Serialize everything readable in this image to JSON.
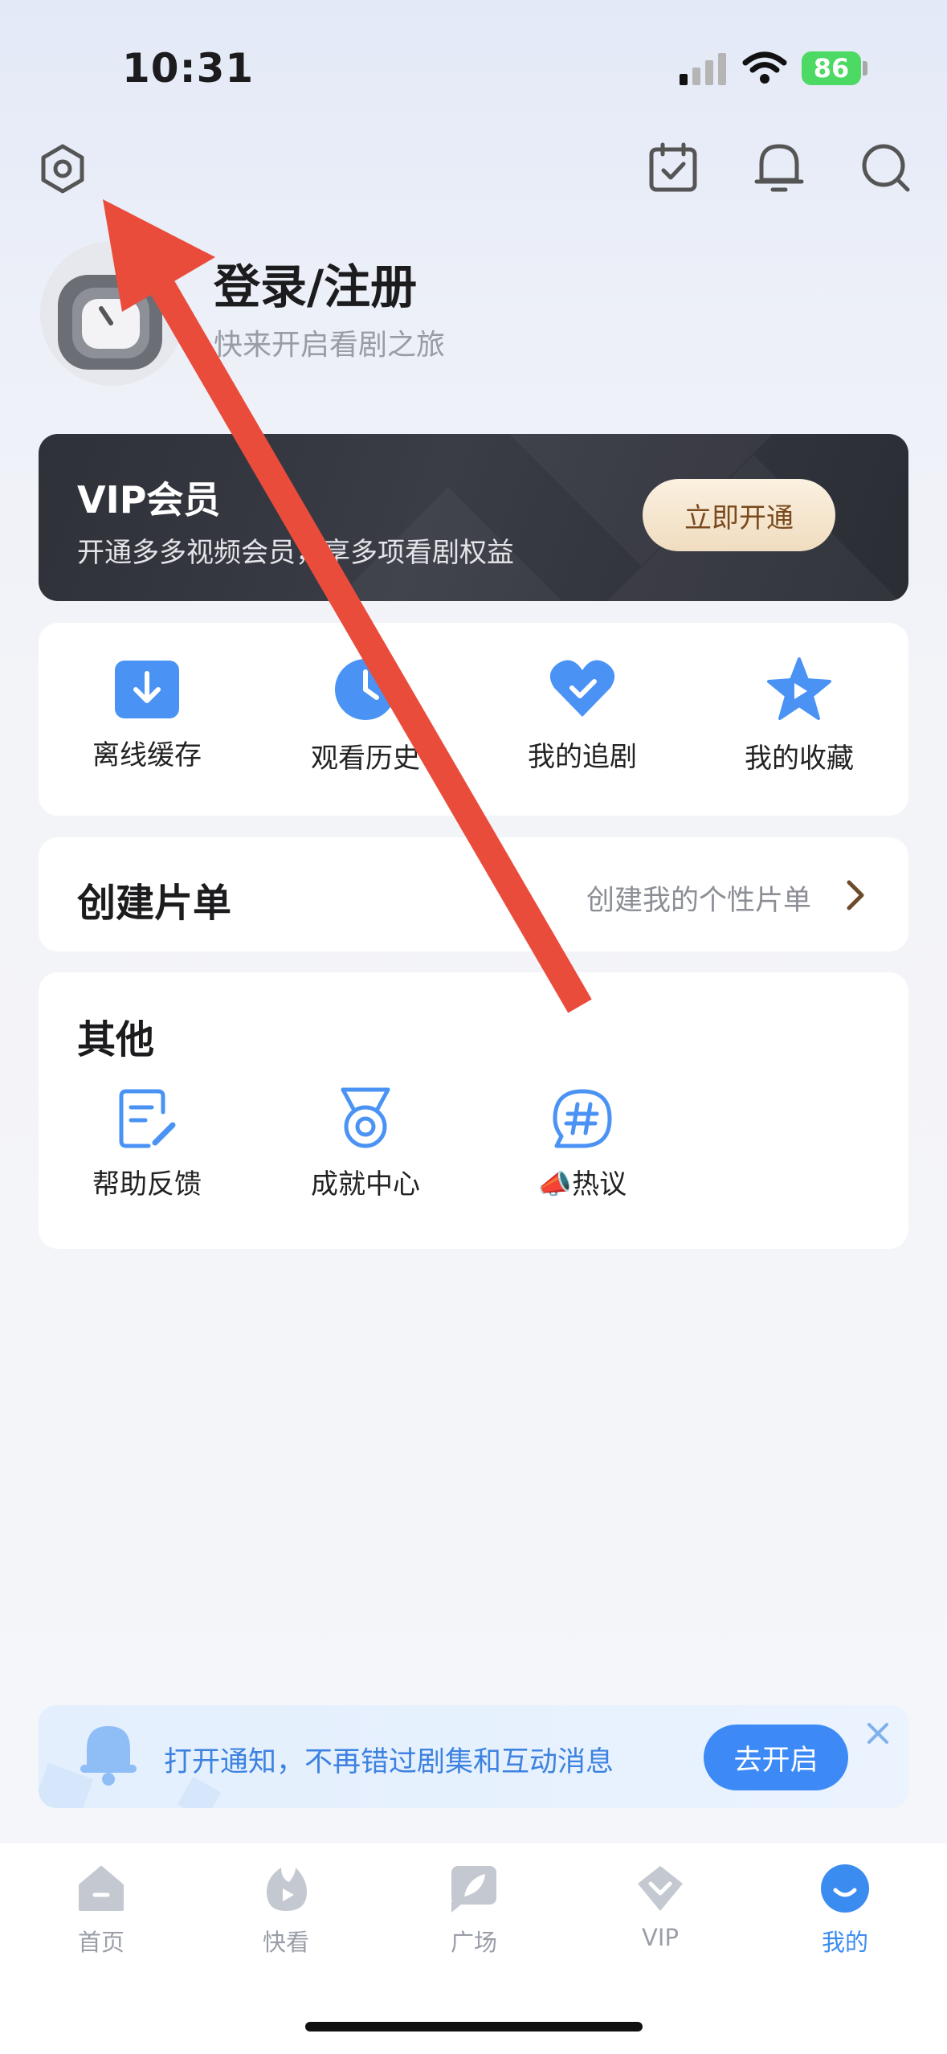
{
  "status_bar": {
    "time": "10:31",
    "battery": "86"
  },
  "header": {
    "settings_icon": "gear-icon",
    "checkin_icon": "calendar-check-icon",
    "notification_icon": "bell-icon",
    "search_icon": "search-icon"
  },
  "profile": {
    "title": "登录/注册",
    "subtitle": "快来开启看剧之旅"
  },
  "vip_banner": {
    "title": "VIP会员",
    "subtitle": "开通多多视频会员，享多项看剧权益",
    "button": "立即开通"
  },
  "quick_actions": [
    {
      "label": "离线缓存",
      "icon": "download-icon"
    },
    {
      "label": "观看历史",
      "icon": "clock-icon"
    },
    {
      "label": "我的追剧",
      "icon": "heart-icon"
    },
    {
      "label": "我的收藏",
      "icon": "star-icon"
    }
  ],
  "playlist": {
    "title": "创建片单",
    "action": "创建我的个性片单"
  },
  "other": {
    "title": "其他",
    "items": [
      {
        "label": "帮助反馈",
        "icon": "feedback-icon"
      },
      {
        "label": "成就中心",
        "icon": "medal-icon"
      },
      {
        "label": "📣热议",
        "icon": "hashtag-icon"
      }
    ]
  },
  "notify_banner": {
    "text": "打开通知，不再错过剧集和互动消息",
    "button": "去开启"
  },
  "tabbar": [
    {
      "label": "首页",
      "icon": "home-icon"
    },
    {
      "label": "快看",
      "icon": "play-flame-icon"
    },
    {
      "label": "广场",
      "icon": "feather-icon"
    },
    {
      "label": "VIP",
      "icon": "vip-diamond-icon"
    },
    {
      "label": "我的",
      "icon": "me-icon"
    }
  ],
  "colors": {
    "accent_blue": "#3d8af7",
    "active_tab": "#3b8cf0",
    "annotation_arrow": "#ea4c3c"
  }
}
